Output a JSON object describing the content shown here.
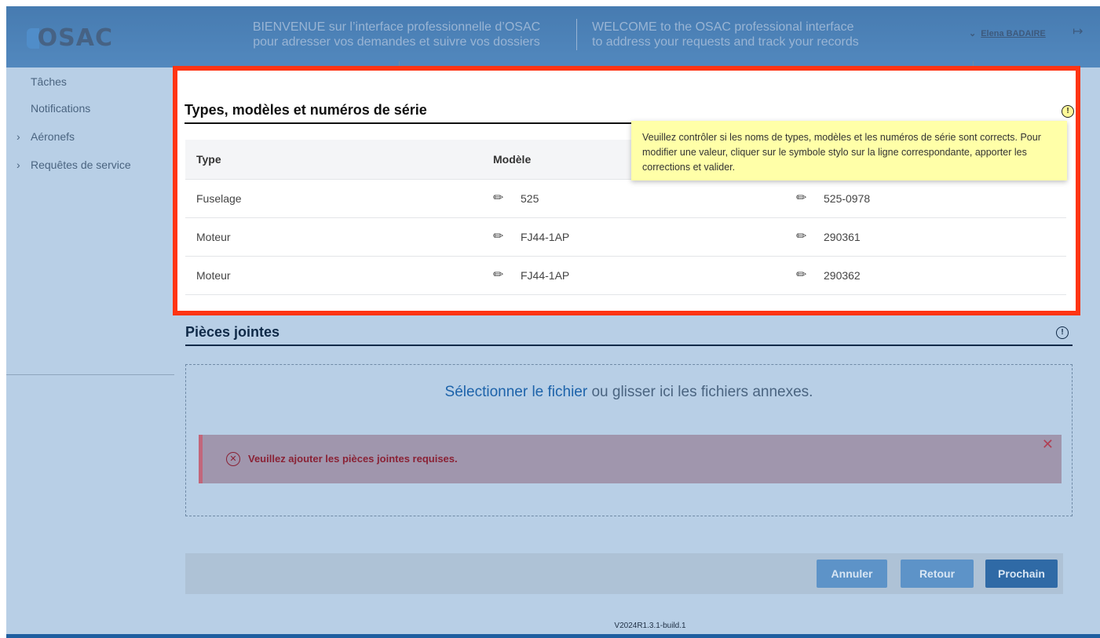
{
  "header": {
    "logo_text": "OSAC",
    "welcome_fr_line1": "BIENVENUE sur l’interface professionnelle d’OSAC",
    "welcome_fr_line2": "pour adresser vos demandes et suivre vos dossiers",
    "welcome_en_line1": "WELCOME to the OSAC professional interface",
    "welcome_en_line2": "to address your requests and track your records",
    "user_name": "Elena BADAIRE",
    "user_chevron_icon": "chevron-down-icon",
    "logout_icon": "logout-icon"
  },
  "nav": {
    "items": [
      {
        "label": "Tâches",
        "expandable": false
      },
      {
        "label": "Notifications",
        "expandable": false
      },
      {
        "label": "Aéronefs",
        "expandable": true
      },
      {
        "label": "Requêtes de service",
        "expandable": true
      }
    ]
  },
  "types_section": {
    "title": "Types, modèles et numéros de série",
    "tooltip": "Veuillez contrôler si les noms de types, modèles et les numéros de série sont corrects. Pour modifier une valeur, cliquer sur le symbole stylo sur la ligne correspondante, apporter les corrections et valider.",
    "columns": [
      "Type",
      "Modèle"
    ],
    "rows": [
      {
        "type": "Fuselage",
        "model": "525",
        "serial": "525-0978"
      },
      {
        "type": "Moteur",
        "model": "FJ44-1AP",
        "serial": "290361"
      },
      {
        "type": "Moteur",
        "model": "FJ44-1AP",
        "serial": "290362"
      }
    ],
    "highlight_color": "#ff3413"
  },
  "attachments": {
    "title": "Pièces jointes",
    "select_link": "Sélectionner le fichier",
    "drop_text": " ou glisser ici les fichiers annexes.",
    "error_message": "Veuillez ajouter les pièces jointes requises."
  },
  "actions": {
    "cancel": "Annuler",
    "back": "Retour",
    "next": "Prochain"
  },
  "version": "V2024R1.3.1-build.1"
}
